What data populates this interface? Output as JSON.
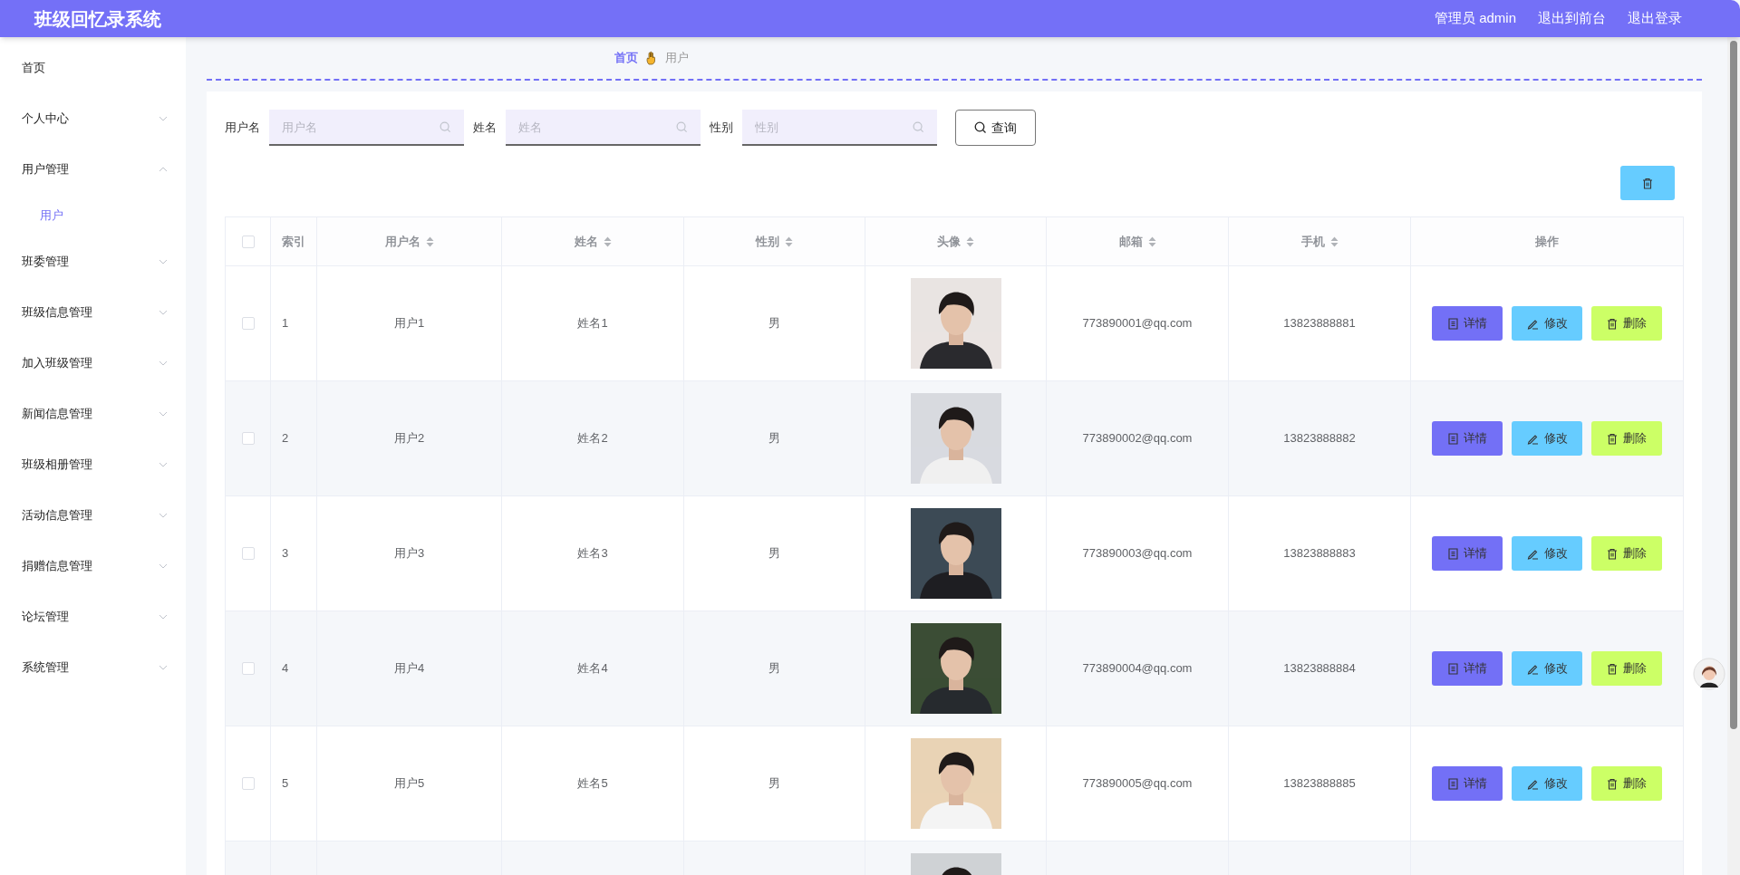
{
  "header": {
    "title": "班级回忆录系统",
    "links": [
      "管理员 admin",
      "退出到前台",
      "退出登录"
    ]
  },
  "sidebar": {
    "items": [
      {
        "label": "首页"
      },
      {
        "label": "个人中心",
        "expanded": false
      },
      {
        "label": "用户管理",
        "expanded": true,
        "children": [
          {
            "label": "用户",
            "selected": true
          }
        ]
      },
      {
        "label": "班委管理",
        "expanded": false
      },
      {
        "label": "班级信息管理",
        "expanded": false
      },
      {
        "label": "加入班级管理",
        "expanded": false
      },
      {
        "label": "新闻信息管理",
        "expanded": false
      },
      {
        "label": "班级相册管理",
        "expanded": false
      },
      {
        "label": "活动信息管理",
        "expanded": false
      },
      {
        "label": "捐赠信息管理",
        "expanded": false
      },
      {
        "label": "论坛管理",
        "expanded": false
      },
      {
        "label": "系统管理",
        "expanded": false
      }
    ]
  },
  "breadcrumb": [
    "首页",
    "用户"
  ],
  "search": {
    "fields": [
      {
        "label": "用户名",
        "placeholder": "用户名"
      },
      {
        "label": "姓名",
        "placeholder": "姓名"
      },
      {
        "label": "性别",
        "placeholder": "性别"
      }
    ],
    "button": "查询"
  },
  "table": {
    "select_all": false,
    "columns": [
      {
        "label": "索引",
        "sortable": false
      },
      {
        "label": "用户名",
        "sortable": true
      },
      {
        "label": "姓名",
        "sortable": true
      },
      {
        "label": "性别",
        "sortable": true
      },
      {
        "label": "头像",
        "sortable": true
      },
      {
        "label": "邮箱",
        "sortable": true
      },
      {
        "label": "手机",
        "sortable": true
      },
      {
        "label": "操作",
        "sortable": false
      }
    ],
    "rows": [
      {
        "checked": false,
        "index": "1",
        "username": "用户1",
        "name": "姓名1",
        "gender": "男",
        "email": "773890001@qq.com",
        "phone": "13823888881",
        "actions": [
          "详情",
          "修改",
          "删除"
        ]
      },
      {
        "checked": false,
        "index": "2",
        "username": "用户2",
        "name": "姓名2",
        "gender": "男",
        "email": "773890002@qq.com",
        "phone": "13823888882",
        "actions": [
          "详情",
          "修改",
          "删除"
        ]
      },
      {
        "checked": false,
        "index": "3",
        "username": "用户3",
        "name": "姓名3",
        "gender": "男",
        "email": "773890003@qq.com",
        "phone": "13823888883",
        "actions": [
          "详情",
          "修改",
          "删除"
        ]
      },
      {
        "checked": false,
        "index": "4",
        "username": "用户4",
        "name": "姓名4",
        "gender": "男",
        "email": "773890004@qq.com",
        "phone": "13823888884",
        "actions": [
          "详情",
          "修改",
          "删除"
        ]
      },
      {
        "checked": false,
        "index": "5",
        "username": "用户5",
        "name": "姓名5",
        "gender": "男",
        "email": "773890005@qq.com",
        "phone": "13823888885",
        "actions": [
          "详情",
          "修改",
          "删除"
        ]
      }
    ]
  }
}
